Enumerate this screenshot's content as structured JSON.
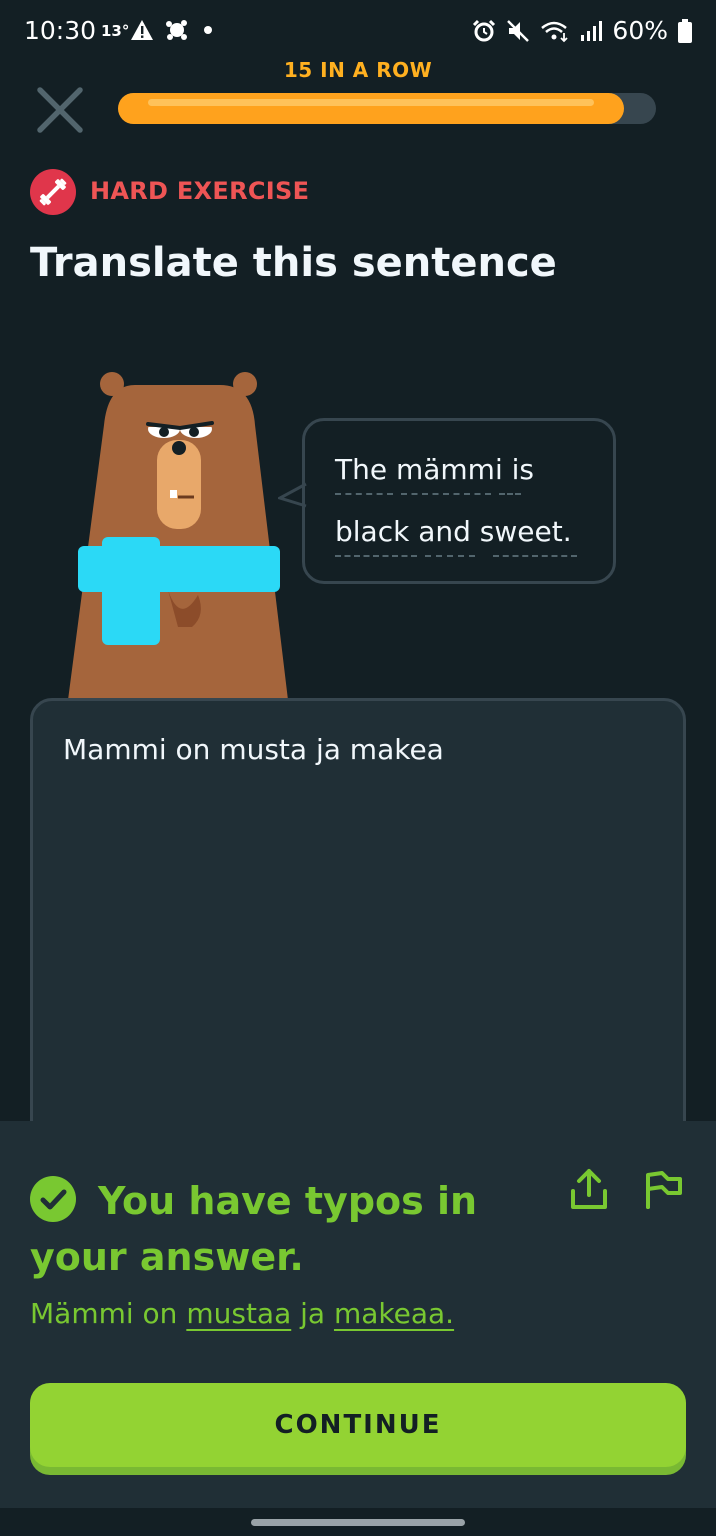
{
  "status_bar": {
    "time": "10:30",
    "temperature": "13°",
    "battery": "60%",
    "icons": [
      "warning-icon",
      "weather-icon",
      "dot-icon",
      "alarm-icon",
      "mute-icon",
      "wifi-icon",
      "signal-icon",
      "battery-icon"
    ]
  },
  "header": {
    "streak": "15 IN A ROW",
    "progress": 0.94
  },
  "exercise": {
    "difficulty": "HARD EXERCISE",
    "instruction": "Translate this sentence",
    "prompt_line1": "The mämmi is",
    "prompt_line2": "black and sweet.",
    "answer": "Mammi on musta ja makea"
  },
  "feedback": {
    "title": "You have typos in your answer.",
    "correction_parts": {
      "p1": "Mämmi on ",
      "p2": "mustaa",
      "p3": " ja ",
      "p4": "makeaa."
    },
    "continue_label": "CONTINUE"
  },
  "colors": {
    "background": "#131f24",
    "panel": "#202f36",
    "streak": "#ffb020",
    "progress": "#ffa21d",
    "hard": "#ee5555",
    "success": "#79c831",
    "button": "#93d333",
    "accent_scarf": "#2bd9f6"
  }
}
